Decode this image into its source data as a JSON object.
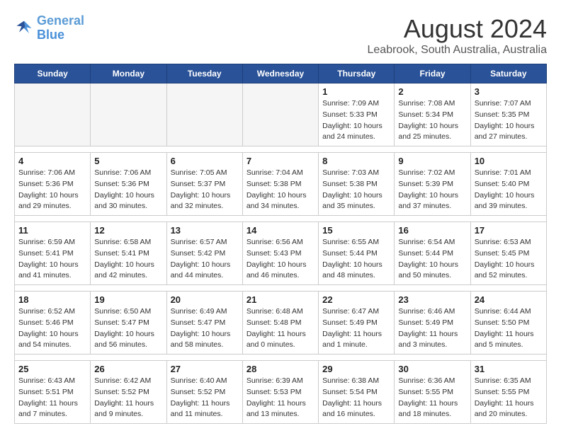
{
  "header": {
    "logo_line1": "General",
    "logo_line2": "Blue",
    "month_title": "August 2024",
    "location": "Leabrook, South Australia, Australia"
  },
  "days_of_week": [
    "Sunday",
    "Monday",
    "Tuesday",
    "Wednesday",
    "Thursday",
    "Friday",
    "Saturday"
  ],
  "weeks": [
    [
      {
        "num": "",
        "info": ""
      },
      {
        "num": "",
        "info": ""
      },
      {
        "num": "",
        "info": ""
      },
      {
        "num": "",
        "info": ""
      },
      {
        "num": "1",
        "info": "Sunrise: 7:09 AM\nSunset: 5:33 PM\nDaylight: 10 hours\nand 24 minutes."
      },
      {
        "num": "2",
        "info": "Sunrise: 7:08 AM\nSunset: 5:34 PM\nDaylight: 10 hours\nand 25 minutes."
      },
      {
        "num": "3",
        "info": "Sunrise: 7:07 AM\nSunset: 5:35 PM\nDaylight: 10 hours\nand 27 minutes."
      }
    ],
    [
      {
        "num": "4",
        "info": "Sunrise: 7:06 AM\nSunset: 5:36 PM\nDaylight: 10 hours\nand 29 minutes."
      },
      {
        "num": "5",
        "info": "Sunrise: 7:06 AM\nSunset: 5:36 PM\nDaylight: 10 hours\nand 30 minutes."
      },
      {
        "num": "6",
        "info": "Sunrise: 7:05 AM\nSunset: 5:37 PM\nDaylight: 10 hours\nand 32 minutes."
      },
      {
        "num": "7",
        "info": "Sunrise: 7:04 AM\nSunset: 5:38 PM\nDaylight: 10 hours\nand 34 minutes."
      },
      {
        "num": "8",
        "info": "Sunrise: 7:03 AM\nSunset: 5:38 PM\nDaylight: 10 hours\nand 35 minutes."
      },
      {
        "num": "9",
        "info": "Sunrise: 7:02 AM\nSunset: 5:39 PM\nDaylight: 10 hours\nand 37 minutes."
      },
      {
        "num": "10",
        "info": "Sunrise: 7:01 AM\nSunset: 5:40 PM\nDaylight: 10 hours\nand 39 minutes."
      }
    ],
    [
      {
        "num": "11",
        "info": "Sunrise: 6:59 AM\nSunset: 5:41 PM\nDaylight: 10 hours\nand 41 minutes."
      },
      {
        "num": "12",
        "info": "Sunrise: 6:58 AM\nSunset: 5:41 PM\nDaylight: 10 hours\nand 42 minutes."
      },
      {
        "num": "13",
        "info": "Sunrise: 6:57 AM\nSunset: 5:42 PM\nDaylight: 10 hours\nand 44 minutes."
      },
      {
        "num": "14",
        "info": "Sunrise: 6:56 AM\nSunset: 5:43 PM\nDaylight: 10 hours\nand 46 minutes."
      },
      {
        "num": "15",
        "info": "Sunrise: 6:55 AM\nSunset: 5:44 PM\nDaylight: 10 hours\nand 48 minutes."
      },
      {
        "num": "16",
        "info": "Sunrise: 6:54 AM\nSunset: 5:44 PM\nDaylight: 10 hours\nand 50 minutes."
      },
      {
        "num": "17",
        "info": "Sunrise: 6:53 AM\nSunset: 5:45 PM\nDaylight: 10 hours\nand 52 minutes."
      }
    ],
    [
      {
        "num": "18",
        "info": "Sunrise: 6:52 AM\nSunset: 5:46 PM\nDaylight: 10 hours\nand 54 minutes."
      },
      {
        "num": "19",
        "info": "Sunrise: 6:50 AM\nSunset: 5:47 PM\nDaylight: 10 hours\nand 56 minutes."
      },
      {
        "num": "20",
        "info": "Sunrise: 6:49 AM\nSunset: 5:47 PM\nDaylight: 10 hours\nand 58 minutes."
      },
      {
        "num": "21",
        "info": "Sunrise: 6:48 AM\nSunset: 5:48 PM\nDaylight: 11 hours\nand 0 minutes."
      },
      {
        "num": "22",
        "info": "Sunrise: 6:47 AM\nSunset: 5:49 PM\nDaylight: 11 hours\nand 1 minute."
      },
      {
        "num": "23",
        "info": "Sunrise: 6:46 AM\nSunset: 5:49 PM\nDaylight: 11 hours\nand 3 minutes."
      },
      {
        "num": "24",
        "info": "Sunrise: 6:44 AM\nSunset: 5:50 PM\nDaylight: 11 hours\nand 5 minutes."
      }
    ],
    [
      {
        "num": "25",
        "info": "Sunrise: 6:43 AM\nSunset: 5:51 PM\nDaylight: 11 hours\nand 7 minutes."
      },
      {
        "num": "26",
        "info": "Sunrise: 6:42 AM\nSunset: 5:52 PM\nDaylight: 11 hours\nand 9 minutes."
      },
      {
        "num": "27",
        "info": "Sunrise: 6:40 AM\nSunset: 5:52 PM\nDaylight: 11 hours\nand 11 minutes."
      },
      {
        "num": "28",
        "info": "Sunrise: 6:39 AM\nSunset: 5:53 PM\nDaylight: 11 hours\nand 13 minutes."
      },
      {
        "num": "29",
        "info": "Sunrise: 6:38 AM\nSunset: 5:54 PM\nDaylight: 11 hours\nand 16 minutes."
      },
      {
        "num": "30",
        "info": "Sunrise: 6:36 AM\nSunset: 5:55 PM\nDaylight: 11 hours\nand 18 minutes."
      },
      {
        "num": "31",
        "info": "Sunrise: 6:35 AM\nSunset: 5:55 PM\nDaylight: 11 hours\nand 20 minutes."
      }
    ]
  ]
}
